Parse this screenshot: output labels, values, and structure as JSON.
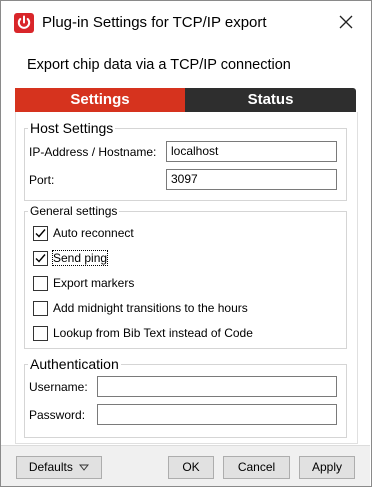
{
  "window": {
    "title": "Plug-in Settings for TCP/IP export",
    "app_icon": "power-icon",
    "close_icon": "close-icon"
  },
  "subtitle": "Export chip data via a TCP/IP connection",
  "tabs": [
    {
      "label": "Settings",
      "selected": true,
      "color": "#d6331e"
    },
    {
      "label": "Status",
      "selected": false,
      "color": "#2e2e2e"
    }
  ],
  "host_settings": {
    "title": "Host Settings",
    "hostname_label": "IP-Address / Hostname:",
    "hostname_value": "localhost",
    "port_label": "Port:",
    "port_value": "3097"
  },
  "general_settings": {
    "title": "General settings",
    "options": [
      {
        "label": "Auto reconnect",
        "checked": true
      },
      {
        "label": "Send ping",
        "checked": true
      },
      {
        "label": "Export markers",
        "checked": false
      },
      {
        "label": "Add midnight transitions to the hours",
        "checked": false
      },
      {
        "label": "Lookup from Bib Text instead of Code",
        "checked": false
      }
    ]
  },
  "authentication": {
    "title": "Authentication",
    "username_label": "Username:",
    "username_value": "",
    "password_label": "Password:",
    "password_value": ""
  },
  "footer": {
    "defaults_label": "Defaults",
    "defaults_icon": "chevron-down-icon",
    "ok_label": "OK",
    "cancel_label": "Cancel",
    "apply_label": "Apply"
  }
}
